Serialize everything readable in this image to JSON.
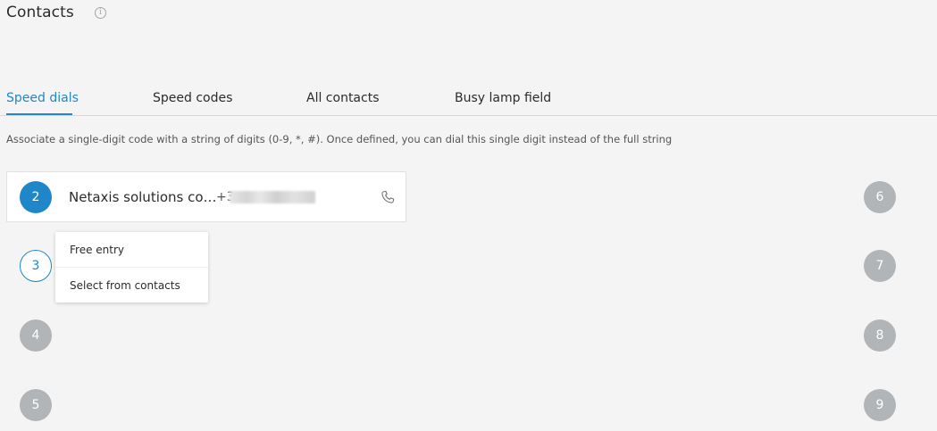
{
  "header": {
    "title": "Contacts",
    "info_icon": "info-icon",
    "info_glyph": "i"
  },
  "tabs": [
    {
      "label": "Speed dials",
      "active": true
    },
    {
      "label": "Speed codes",
      "active": false
    },
    {
      "label": "All contacts",
      "active": false
    },
    {
      "label": "Busy lamp field",
      "active": false
    }
  ],
  "description": "Associate a single-digit code with a string of digits (0-9, *, #). Once defined, you can dial this single digit instead of the full string",
  "speed_dials": {
    "assigned": {
      "digit": "2",
      "name": "Netaxis solutions co…",
      "number_prefix": "+3",
      "action_icon": "phone-icon"
    },
    "selected_digit": "3",
    "empty_left": [
      "4",
      "5"
    ],
    "empty_right": [
      "6",
      "7",
      "8",
      "9"
    ]
  },
  "dropdown_menu": {
    "items": [
      "Free entry",
      "Select from contacts"
    ]
  },
  "colors": {
    "accent": "#1f87c9",
    "empty_badge": "#b1b5b8",
    "background": "#f4f4f4"
  }
}
